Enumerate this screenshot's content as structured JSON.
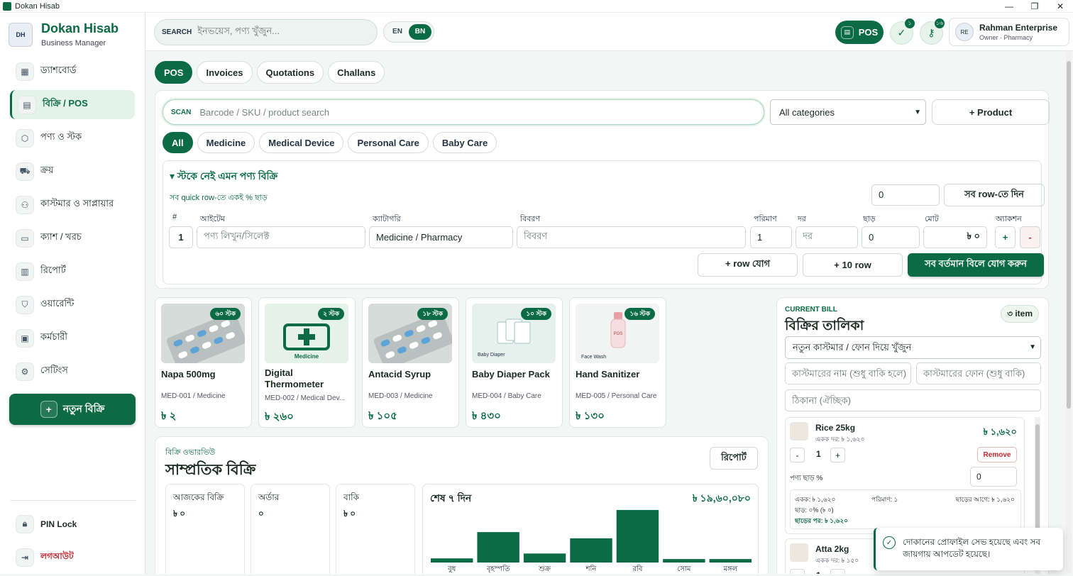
{
  "window": {
    "title": "Dokan Hisab",
    "controls": [
      "—",
      "❐",
      "✕"
    ]
  },
  "brand": {
    "logo_text": "DH",
    "name": "Dokan Hisab",
    "subtitle": "Business Manager"
  },
  "sidebar": {
    "items": [
      {
        "label": "ড্যাশবোর্ড",
        "icon": "dashboard-icon",
        "glyph": "▦"
      },
      {
        "label": "বিক্রি / POS",
        "icon": "pos-icon",
        "glyph": "▤",
        "active": true
      },
      {
        "label": "পণ্য ও স্টক",
        "icon": "box-icon",
        "glyph": "⬡"
      },
      {
        "label": "ক্রয়",
        "icon": "truck-icon",
        "glyph": "⛟"
      },
      {
        "label": "কাস্টমার ও সাপ্লায়ার",
        "icon": "users-icon",
        "glyph": "⚇"
      },
      {
        "label": "ক্যাশ / খরচ",
        "icon": "wallet-icon",
        "glyph": "▭"
      },
      {
        "label": "রিপোর্ট",
        "icon": "bar-chart-icon",
        "glyph": "▥"
      },
      {
        "label": "ওয়ারেন্টি",
        "icon": "shield-icon",
        "glyph": "⛉"
      },
      {
        "label": "কর্মচারী",
        "icon": "calendar-icon",
        "glyph": "▣"
      },
      {
        "label": "সেটিংস",
        "icon": "gear-icon",
        "glyph": "⚙"
      }
    ],
    "new_sale": "নতুন বিক্রি",
    "bottom": [
      {
        "label": "PIN Lock",
        "icon": "lock-icon",
        "glyph": "🔒︎"
      },
      {
        "label": "লগআউট",
        "icon": "logout-icon",
        "glyph": "⇥",
        "color": "#c0282e"
      }
    ]
  },
  "header": {
    "search_label": "SEARCH",
    "search_placeholder": "ইনভয়েস, পণ্য খুঁজুন...",
    "lang": [
      "EN",
      "BN"
    ],
    "pos_label": "POS",
    "badge_check": "১",
    "badge_key": "১৬",
    "profile_avatar": "RE",
    "profile_name": "Rahman Enterprise",
    "profile_role": "Owner · Pharmacy"
  },
  "tabs": [
    "POS",
    "Invoices",
    "Quotations",
    "Challans"
  ],
  "pos": {
    "scan_label": "SCAN",
    "scan_placeholder": "Barcode / SKU / product search",
    "category_select": "All categories",
    "add_product": "+ Product",
    "chips": [
      "All",
      "Medicine",
      "Medical Device",
      "Personal Care",
      "Baby Care"
    ]
  },
  "quick": {
    "title": "▾ স্টকে নেই এমন পণ্য বিক্রি",
    "subtitle": "সব quick row-তে একই % ছাড়",
    "discount_value": "0",
    "apply_all": "সব row-তে দিন",
    "headers": [
      "#",
      "আইটেম",
      "ক্যাটাগরি",
      "বিবরণ",
      "পরিমাণ",
      "দর",
      "ছাড়",
      "মোট",
      "অ্যাকশন"
    ],
    "row": {
      "num": "1",
      "item_ph": "পণ্য লিখুন/সিলেক্ট",
      "category": "Medicine / Pharmacy",
      "desc_ph": "বিবরণ",
      "qty": "1",
      "rate_ph": "দর",
      "discount": "0",
      "total": "৳ ০",
      "plus": "+",
      "minus": "-"
    },
    "add_row": "+ row যোগ",
    "add_10": "+ 10 row",
    "add_all": "সব বর্তমান বিলে যোগ করুন"
  },
  "products": [
    {
      "name": "Napa 500mg",
      "sku": "MED-001 / Medicine",
      "price": "৳ ২",
      "stock": "৬০ স্টক",
      "img": "pills"
    },
    {
      "name": "Digital Thermometer",
      "sku": "MED-002 / Medical Dev...",
      "price": "৳ ২৬০",
      "stock": "২ স্টক",
      "img": "medicine",
      "img_label": "Medicine"
    },
    {
      "name": "Antacid Syrup",
      "sku": "MED-003 / Medicine",
      "price": "৳ ১০৫",
      "stock": "১৮ স্টক",
      "img": "pills"
    },
    {
      "name": "Baby Diaper Pack",
      "sku": "MED-004 / Baby Care",
      "price": "৳ ৪৩০",
      "stock": "১০ স্টক",
      "img": "diaper",
      "img_label": "Baby Diaper"
    },
    {
      "name": "Hand Sanitizer",
      "sku": "MED-005 / Personal Care",
      "price": "৳ ১৩০",
      "stock": "১৬ স্টক",
      "img": "bottle",
      "img_label": "Face Wash",
      "bottle_label": "POS"
    }
  ],
  "overview": {
    "sub": "বিক্রি ওভারভিউ",
    "title": "সাম্প্রতিক বিক্রি",
    "report_btn": "রিপোর্ট",
    "stats": [
      {
        "label": "আজকের বিক্রি",
        "value": "৳ ০"
      },
      {
        "label": "অর্ডার",
        "value": "০"
      },
      {
        "label": "বাকি",
        "value": "৳ ০"
      }
    ]
  },
  "chart_data": {
    "type": "bar",
    "title": "শেষ ৭ দিন",
    "total_label": "৳ ১৯,৬০,০৮০",
    "categories": [
      "বুধ",
      "বৃহস্পতি",
      "শুক্র",
      "শনি",
      "রবি",
      "সোম",
      "মঙ্গল"
    ],
    "values": [
      6,
      44,
      13,
      35,
      76,
      5,
      5
    ],
    "ylim": [
      0,
      80
    ],
    "color": "#0b6b45"
  },
  "bill": {
    "label": "CURRENT BILL",
    "title": "বিক্রির তালিকা",
    "count": "৩ item",
    "customer_select": "নতুন কাস্টমার / ফোন দিয়ে খুঁজুন",
    "name_ph": "কাস্টমারের নাম (শুধু বাকি হলে)",
    "phone_ph": "কাস্টমারের ফোন (শুধু বাকি)",
    "address_ph": "ঠিকানা (ঐচ্ছিক)",
    "items": [
      {
        "name": "Rice 25kg",
        "unit_price": "একক দর: ৳ ১,৬২০",
        "price": "৳ ১,৬২০",
        "qty": "1",
        "remove": "Remove",
        "discount_label": "পণ্য ছাড় %",
        "discount_value": "0",
        "sum_unit": "একক: ৳ ১,৬২০",
        "sum_qty": "পরিমাণ: ১",
        "sum_before": "ছাড়ের আগে: ৳ ১,৬২০",
        "sum_disc": "ছাড়: ০% (৳ ০)",
        "sum_after": "ছাড়ের পর: ৳ ১,৬২০"
      },
      {
        "name": "Atta 2kg",
        "unit_price": "একক দর: ৳ ১৫০",
        "qty": "1"
      }
    ],
    "qty_minus": "-",
    "qty_plus": "+"
  },
  "toast": {
    "check": "✓",
    "message": "দোকানের প্রোফাইল সেভ হয়েছে এবং সব জায়গায় আপডেট হয়েছে।"
  }
}
